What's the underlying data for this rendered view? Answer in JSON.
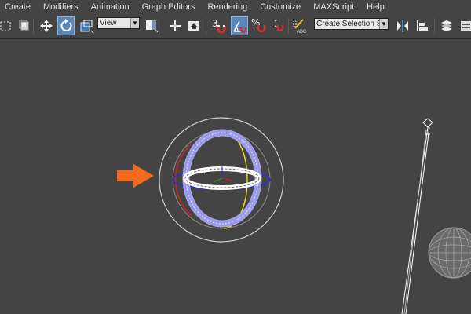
{
  "menubar": {
    "items": [
      {
        "id": "create",
        "label": "Create"
      },
      {
        "id": "modifiers",
        "label": "Modifiers"
      },
      {
        "id": "animation",
        "label": "Animation"
      },
      {
        "id": "graph-editors",
        "label": "Graph Editors"
      },
      {
        "id": "rendering",
        "label": "Rendering"
      },
      {
        "id": "customize",
        "label": "Customize"
      },
      {
        "id": "maxscript",
        "label": "MAXScript"
      },
      {
        "id": "help",
        "label": "Help"
      }
    ]
  },
  "toolbar": {
    "reference_coord_system": "View",
    "snap_toggle_label": "3",
    "angle_snap_label": "",
    "percent_snap_label": "%",
    "named_selection_placeholder": "Create Selection Se",
    "active_tool": "rotate",
    "icons": [
      "select-region-icon",
      "select-object-icon",
      "move-icon",
      "rotate-icon",
      "scale-icon",
      "mirror-icon",
      "align-icon",
      "layer-icon"
    ]
  },
  "viewport": {
    "annotation_arrow_color": "#f26b1d",
    "gizmo_axis_colors": {
      "x": "#d22020",
      "y": "#e8d820",
      "z": "#2b2bd8"
    },
    "selection_color": "#ffffff"
  }
}
